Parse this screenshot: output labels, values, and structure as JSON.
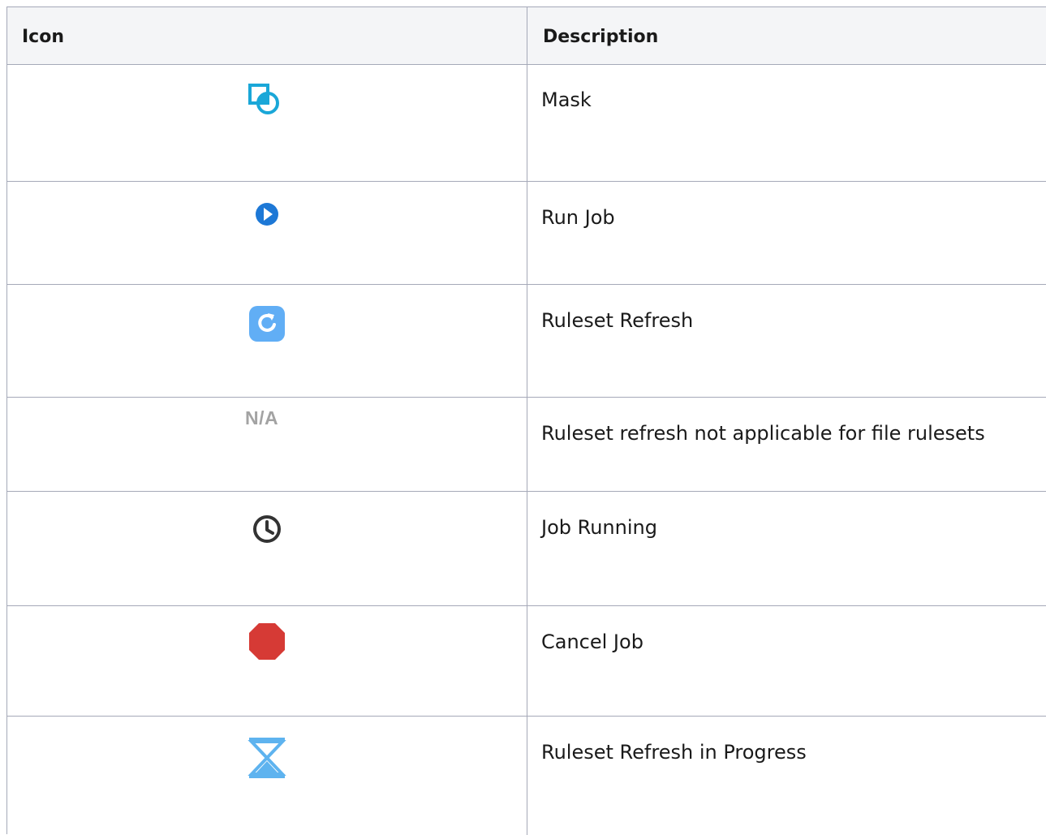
{
  "table": {
    "headers": {
      "icon": "Icon",
      "description": "Description"
    },
    "rows": [
      {
        "icon": "mask-icon",
        "description": "Mask"
      },
      {
        "icon": "run-job-icon",
        "description": "Run Job"
      },
      {
        "icon": "ruleset-refresh-icon",
        "description": "Ruleset Refresh"
      },
      {
        "icon": "not-applicable-icon",
        "icon_text": "N/A",
        "description": "Ruleset refresh not applicable for file rulesets"
      },
      {
        "icon": "clock-icon",
        "description": "Job Running"
      },
      {
        "icon": "cancel-job-icon",
        "description": "Cancel Job"
      },
      {
        "icon": "hourglass-icon",
        "description": "Ruleset Refresh in Progress"
      }
    ]
  },
  "colors": {
    "border": "#a5a9b8",
    "header_bg": "#f4f5f7",
    "mask_blue": "#1aa7d8",
    "run_blue": "#1d78d6",
    "refresh_blue": "#61aef5",
    "na_gray": "#a3a3a3",
    "clock_dark": "#333333",
    "cancel_red": "#d63a35",
    "hourglass_blue": "#5eb3ef"
  }
}
